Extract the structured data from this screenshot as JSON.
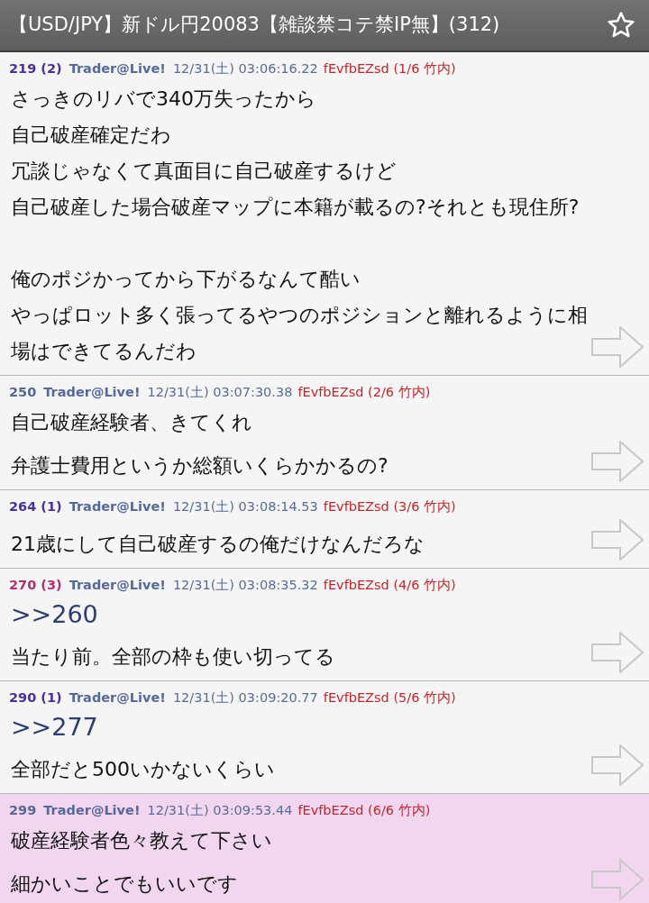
{
  "title_bar": {
    "title": "【USD/JPY】新ドル円20083【雑談禁コテ禁IP無】(312)"
  },
  "posts": [
    {
      "number": "219",
      "reply_count": "(2)",
      "color": "#4b2f9c",
      "name": "Trader@Live!",
      "date": "12/31(土) 03:06:16.22",
      "id": "fEvfbEZsd (1/6 竹内)",
      "highlighted": false,
      "paragraphs": [
        [
          "さっきのリバで340万失ったから",
          "自己破産確定だわ",
          "冗談じゃなくて真面目に自己破産するけど",
          "自己破産した場合破産マップに本籍が載るの?それとも現住所?"
        ],
        [
          "俺のポジかってから下がるなんて酷い",
          "やっぱロット多く張ってるやつのポジションと離れるように相場はできてるんだわ"
        ]
      ]
    },
    {
      "number": "250",
      "color": "#56688f",
      "name": "Trader@Live!",
      "date": "12/31(土) 03:07:30.38",
      "id": "fEvfbEZsd (2/6 竹内)",
      "highlighted": false,
      "paragraphs": [
        [
          "自己破産経験者、きてくれ",
          "弁護士費用というか総額いくらかかるの?"
        ]
      ]
    },
    {
      "number": "264",
      "reply_count": "(1)",
      "color": "#4b2f9c",
      "name": "Trader@Live!",
      "date": "12/31(土) 03:08:14.53",
      "id": "fEvfbEZsd (3/6 竹内)",
      "highlighted": false,
      "paragraphs": [
        [
          "21歳にして自己破産するの俺だけなんだろな"
        ]
      ]
    },
    {
      "number": "270",
      "reply_count": "(3)",
      "color": "#b0306e",
      "name": "Trader@Live!",
      "date": "12/31(土) 03:08:35.32",
      "id": "fEvfbEZsd (4/6 竹内)",
      "highlighted": false,
      "anchor": ">>260",
      "paragraphs": [
        [
          "当たり前。全部の枠も使い切ってる"
        ]
      ]
    },
    {
      "number": "290",
      "reply_count": "(1)",
      "color": "#4b2f9c",
      "name": "Trader@Live!",
      "date": "12/31(土) 03:09:20.77",
      "id": "fEvfbEZsd (5/6 竹内)",
      "highlighted": false,
      "anchor": ">>277",
      "paragraphs": [
        [
          "全部だと500いかないくらい"
        ]
      ]
    },
    {
      "number": "299",
      "color": "#56688f",
      "name": "Trader@Live!",
      "date": "12/31(土) 03:09:53.44",
      "id": "fEvfbEZsd (6/6 竹内)",
      "highlighted": true,
      "paragraphs": [
        [
          "破産経験者色々教えて下さい",
          "細かいことでもいいです"
        ]
      ]
    }
  ]
}
